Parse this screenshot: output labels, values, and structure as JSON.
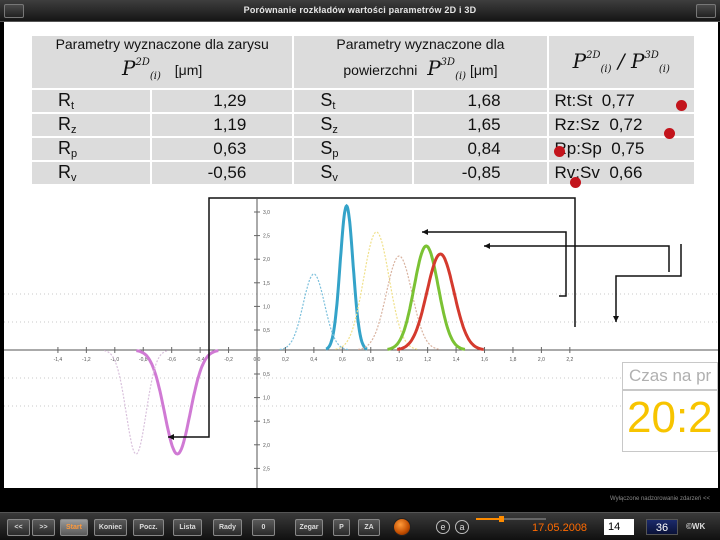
{
  "window": {
    "title": "Porównanie rozkładów wartości parametrów 2D i 3D"
  },
  "table": {
    "header_col1": "Parametry wyznaczone dla zarysu",
    "header_col2_line1": "Parametry wyznaczone dla",
    "header_col2_line2": "powierzchni",
    "header_ratio": "P / P",
    "unit": "[μm]",
    "rows": [
      {
        "p2d": "R",
        "p2d_sub": "t",
        "v2d": "1,29",
        "p3d": "S",
        "p3d_sub": "t",
        "v3d": "1,68",
        "ratio": "Rt:St",
        "rv": "0,77"
      },
      {
        "p2d": "R",
        "p2d_sub": "z",
        "v2d": "1,19",
        "p3d": "S",
        "p3d_sub": "z",
        "v3d": "1,65",
        "ratio": "Rz:Sz",
        "rv": "0,72"
      },
      {
        "p2d": "R",
        "p2d_sub": "p",
        "v2d": "0,63",
        "p3d": "S",
        "p3d_sub": "p",
        "v3d": "0,84",
        "ratio": "Rp:Sp",
        "rv": "0,75"
      },
      {
        "p2d": "R",
        "p2d_sub": "v",
        "v2d": "-0,56",
        "p3d": "S",
        "p3d_sub": "v",
        "v3d": "-0,85",
        "ratio": "Rv:Sv",
        "rv": "0,66"
      }
    ]
  },
  "chart": {
    "x_ticks": [
      "-1,4",
      "-1,2",
      "-1,0",
      "-0,8",
      "-0,6",
      "-0,4",
      "-0,2",
      "0,0",
      "0,2",
      "0,4",
      "0,6",
      "0,8",
      "1,0",
      "1,2",
      "1,4",
      "1,6",
      "1,8",
      "2,0",
      "2,2"
    ],
    "y_ticks_pos": [
      "3,0",
      "2,5",
      "2,0",
      "1,5",
      "1,0",
      "0,5"
    ],
    "y_ticks_neg": [
      "0,5",
      "1,0",
      "1,5",
      "2,0",
      "2,5",
      "3,0"
    ],
    "colors": {
      "rv": "#d07ad4",
      "sv": "#d9c1dc",
      "rp": "#34a3c9",
      "sp": "#7cc0dc",
      "rt": "#f0e08a",
      "st": "#d9b3a0",
      "rz": "#7bc234",
      "sz": "#d43a2e"
    }
  },
  "clock": {
    "label": "Czas na pr",
    "time": "20:2"
  },
  "footnote": "Wyłączone nadzorowanie zdarzeń <<",
  "toolbar": {
    "prev": "<<",
    "next": ">>",
    "start": "Start",
    "end": "Koniec",
    "first": "Pocz.",
    "list": "Lista",
    "hints": "Rady",
    "zero": "0",
    "clock": "Zegar",
    "p": "P",
    "za": "ZA",
    "e": "e",
    "a": "a",
    "date": "17.05.2008",
    "slide": "14",
    "total": "36",
    "copyright": "©WK"
  },
  "progress": 0.36
}
